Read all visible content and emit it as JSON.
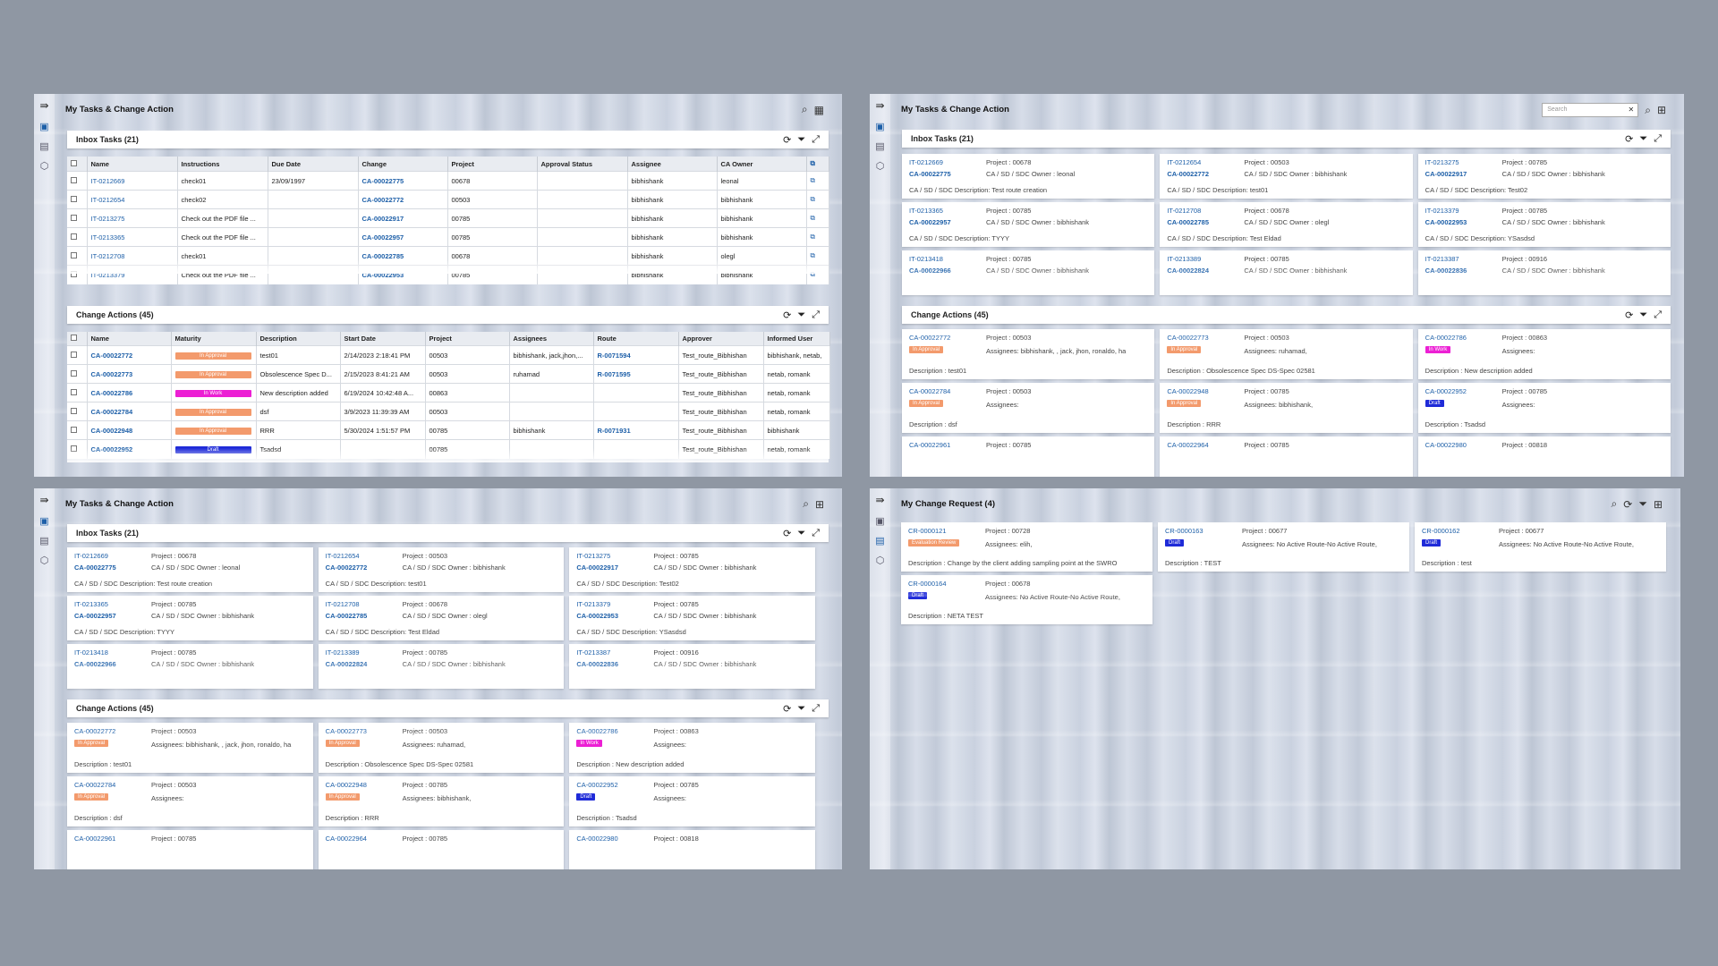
{
  "panels": {
    "tasks_title": "My Tasks & Change Action",
    "cr_title": "My Change Request (4)"
  },
  "search": {
    "placeholder": "Search"
  },
  "inbox": {
    "title": "Inbox Tasks (21)",
    "columns": [
      "Name",
      "Instructions",
      "Due Date",
      "Change",
      "Project",
      "Approval Status",
      "Assignee",
      "CA Owner"
    ],
    "rows": [
      {
        "name": "IT-0212669",
        "instructions": "check01",
        "due": "23/09/1997",
        "change": "CA-00022775",
        "project": "00678",
        "status": "",
        "assignee": "bibhishank",
        "owner": "leonal"
      },
      {
        "name": "IT-0212654",
        "instructions": "check02",
        "due": "",
        "change": "CA-00022772",
        "project": "00503",
        "status": "",
        "assignee": "bibhishank",
        "owner": "bibhishank"
      },
      {
        "name": "IT-0213275",
        "instructions": "Check out the PDF file ...",
        "due": "",
        "change": "CA-00022917",
        "project": "00785",
        "status": "",
        "assignee": "bibhishank",
        "owner": "bibhishank"
      },
      {
        "name": "IT-0213365",
        "instructions": "Check out the PDF file ...",
        "due": "",
        "change": "CA-00022957",
        "project": "00785",
        "status": "",
        "assignee": "bibhishank",
        "owner": "bibhishank"
      },
      {
        "name": "IT-0212708",
        "instructions": "check01",
        "due": "",
        "change": "CA-00022785",
        "project": "00678",
        "status": "",
        "assignee": "bibhishank",
        "owner": "olegl"
      },
      {
        "name": "IT-0213379",
        "instructions": "Check out the PDF file ...",
        "due": "",
        "change": "CA-00022953",
        "project": "00785",
        "status": "",
        "assignee": "bibhishank",
        "owner": "bibhishank"
      }
    ],
    "cards": [
      {
        "id": "IT-0212669",
        "project": "Project : 00678",
        "ca": "CA-00022775",
        "owner": "CA / SD / SDC Owner :  leonal",
        "desc": "CA / SD / SDC Description:  Test route creation"
      },
      {
        "id": "IT-0212654",
        "project": "Project : 00503",
        "ca": "CA-00022772",
        "owner": "CA / SD / SDC Owner :  bibhishank",
        "desc": "CA / SD / SDC Description:  test01"
      },
      {
        "id": "IT-0213275",
        "project": "Project : 00785",
        "ca": "CA-00022917",
        "owner": "CA / SD / SDC Owner :  bibhishank",
        "desc": "CA / SD / SDC Description:  Test02"
      },
      {
        "id": "IT-0213365",
        "project": "Project : 00785",
        "ca": "CA-00022957",
        "owner": "CA / SD / SDC Owner :  bibhishank",
        "desc": "CA / SD / SDC Description:  TYYY"
      },
      {
        "id": "IT-0212708",
        "project": "Project : 00678",
        "ca": "CA-00022785",
        "owner": "CA / SD / SDC Owner :  olegl",
        "desc": "CA / SD / SDC Description:  Test Eldad"
      },
      {
        "id": "IT-0213379",
        "project": "Project : 00785",
        "ca": "CA-00022953",
        "owner": "CA / SD / SDC Owner :  bibhishank",
        "desc": "CA / SD / SDC Description:  YSasdsd"
      },
      {
        "id": "IT-0213418",
        "project": "Project : 00785",
        "ca": "CA-00022966",
        "owner": "CA / SD / SDC Owner :  bibhishank",
        "desc": ""
      },
      {
        "id": "IT-0213389",
        "project": "Project : 00785",
        "ca": "CA-00022824",
        "owner": "CA / SD / SDC Owner :  bibhishank",
        "desc": ""
      },
      {
        "id": "IT-0213387",
        "project": "Project : 00916",
        "ca": "CA-00022836",
        "owner": "CA / SD / SDC Owner :  bibhishank",
        "desc": ""
      }
    ]
  },
  "ca": {
    "title": "Change Actions (45)",
    "columns": [
      "Name",
      "Maturity",
      "Description",
      "Start Date",
      "Project",
      "Assignees",
      "Route",
      "Approver",
      "Informed User"
    ],
    "rows": [
      {
        "name": "CA-00022772",
        "maturity": "In Approval",
        "color": "#f39a6c",
        "desc": "test01",
        "start": "2/14/2023 2:18:41 PM",
        "project": "00503",
        "assignees": "bibhishank, jack,jhon,...",
        "route": "R-0071594",
        "approver": "Test_route_Bibhishan",
        "informed": "bibhishank, netab,"
      },
      {
        "name": "CA-00022773",
        "maturity": "In Approval",
        "color": "#f39a6c",
        "desc": "Obsolescence Spec D...",
        "start": "2/15/2023 8:41:21 AM",
        "project": "00503",
        "assignees": "ruhamad",
        "route": "R-0071595",
        "approver": "Test_route_Bibhishan",
        "informed": "netab, romank"
      },
      {
        "name": "CA-00022786",
        "maturity": "In Work",
        "color": "#ec1fd4",
        "desc": "New description added",
        "start": "6/19/2024 10:42:48 A...",
        "project": "00863",
        "assignees": "",
        "route": "",
        "approver": "Test_route_Bibhishan",
        "informed": "netab, romank"
      },
      {
        "name": "CA-00022784",
        "maturity": "In Approval",
        "color": "#f39a6c",
        "desc": "dsf",
        "start": "3/9/2023 11:39:39 AM",
        "project": "00503",
        "assignees": "",
        "route": "",
        "approver": "Test_route_Bibhishan",
        "informed": "netab, romank"
      },
      {
        "name": "CA-00022948",
        "maturity": "In Approval",
        "color": "#f39a6c",
        "desc": "RRR",
        "start": "5/30/2024 1:51:57 PM",
        "project": "00785",
        "assignees": "bibhishank",
        "route": "R-0071931",
        "approver": "Test_route_Bibhishan",
        "informed": "bibhishank"
      },
      {
        "name": "CA-00022952",
        "maturity": "Draft",
        "color": "#1f2bd8",
        "desc": "Tsadsd",
        "start": "",
        "project": "00785",
        "assignees": "",
        "route": "",
        "approver": "Test_route_Bibhishan",
        "informed": "netab, romank"
      }
    ],
    "cards": [
      {
        "id": "CA-00022772",
        "project": "Project : 00503",
        "badge": "In Approval",
        "color": "#f39a6c",
        "assignees": "Assignees:  bibhishank, , jack, jhon, ronaldo, ha",
        "desc": "Description  :  test01"
      },
      {
        "id": "CA-00022773",
        "project": "Project : 00503",
        "badge": "In Approval",
        "color": "#f39a6c",
        "assignees": "Assignees:  ruhamad,",
        "desc": "Description  :  Obsolescence Spec DS-Spec 02581"
      },
      {
        "id": "CA-00022786",
        "project": "Project : 00863",
        "badge": "In Work",
        "color": "#ec1fd4",
        "assignees": "Assignees:",
        "desc": "Description  :  New description added"
      },
      {
        "id": "CA-00022784",
        "project": "Project : 00503",
        "badge": "In Approval",
        "color": "#f39a6c",
        "assignees": "Assignees:",
        "desc": "Description  :  dsf"
      },
      {
        "id": "CA-00022948",
        "project": "Project : 00785",
        "badge": "In Approval",
        "color": "#f39a6c",
        "assignees": "Assignees:  bibhishank,",
        "desc": "Description  :  RRR"
      },
      {
        "id": "CA-00022952",
        "project": "Project : 00785",
        "badge": "Draft",
        "color": "#1f2bd8",
        "assignees": "Assignees:",
        "desc": "Description  :  Tsadsd"
      },
      {
        "id": "CA-00022961",
        "project": "Project : 00785",
        "badge": "",
        "color": "#f39a6c",
        "assignees": "",
        "desc": ""
      },
      {
        "id": "CA-00022964",
        "project": "Project : 00785",
        "badge": "",
        "color": "#f39a6c",
        "assignees": "",
        "desc": ""
      },
      {
        "id": "CA-00022980",
        "project": "Project : 00818",
        "badge": "",
        "color": "#f39a6c",
        "assignees": "",
        "desc": ""
      }
    ]
  },
  "cr": {
    "cards": [
      {
        "id": "CR-0000121",
        "project": "Project : 00728",
        "badge": "Evaluation Review",
        "color": "#f39a6c",
        "assignees": "Assignees:  elih,",
        "desc": "Description  :  Change by the client adding sampling point at the SWRO"
      },
      {
        "id": "CR-0000163",
        "project": "Project : 00677",
        "badge": "Draft",
        "color": "#1f2bd8",
        "assignees": "Assignees:  No Active Route-No Active Route,",
        "desc": "Description  :  TEST"
      },
      {
        "id": "CR-0000162",
        "project": "Project : 00677",
        "badge": "Draft",
        "color": "#1f2bd8",
        "assignees": "Assignees:  No Active Route-No Active Route,",
        "desc": "Description  :  test"
      },
      {
        "id": "CR-0000164",
        "project": "Project : 00678",
        "badge": "Draft",
        "color": "#1f2bd8",
        "assignees": "Assignees:  No Active Route-No Active Route,",
        "desc": "Description  :  NETA TEST"
      }
    ]
  },
  "icons": {
    "menu": "menu-expand-icon",
    "tasks": "clipboard-icon",
    "docs": "document-icon",
    "box": "package-icon",
    "search": "search-icon",
    "view": "grid-view-icon",
    "refresh": "refresh-icon",
    "filter": "filter-icon",
    "expand": "expand-icon"
  }
}
